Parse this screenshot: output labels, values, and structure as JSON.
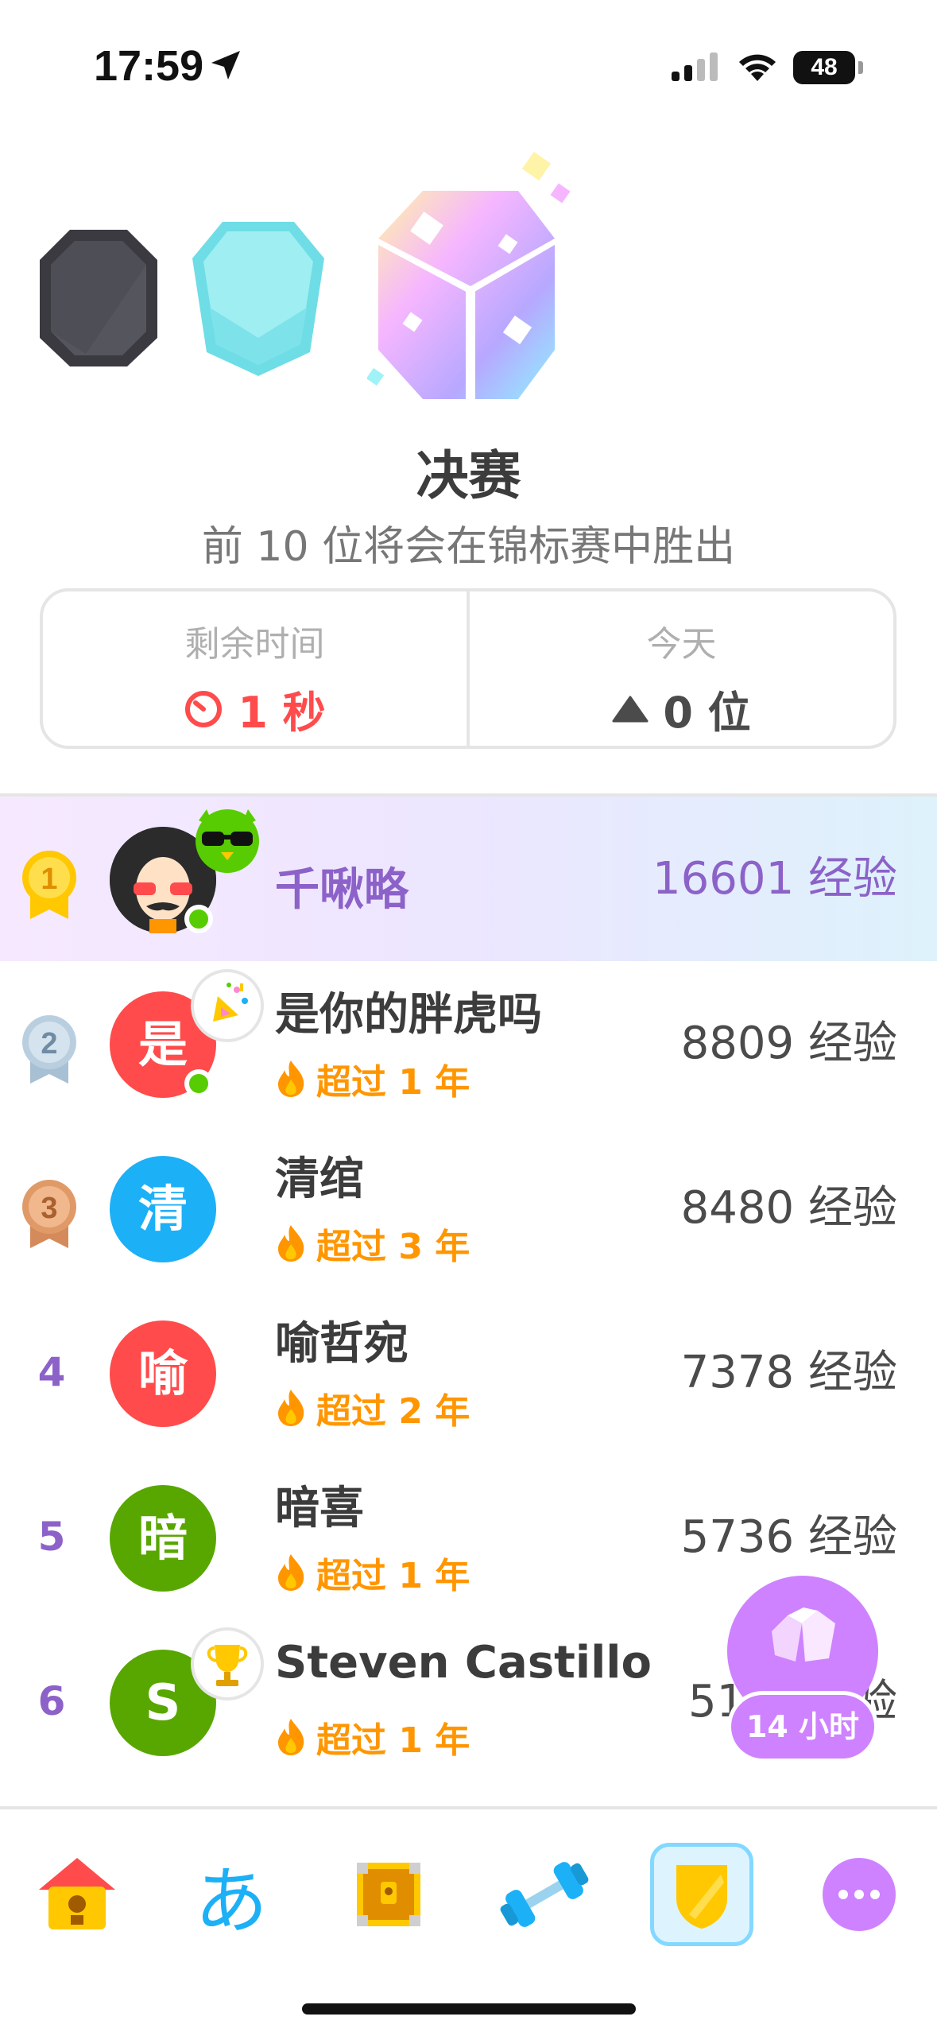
{
  "status_bar": {
    "time": "17:59",
    "battery": "48",
    "icons": [
      "location-arrow-icon",
      "cellular-signal-icon",
      "wifi-icon",
      "battery-icon"
    ]
  },
  "league": {
    "title": "决赛",
    "subtitle": "前 10 位将会在锦标赛中胜出",
    "gems": [
      "obsidian-gem-icon",
      "diamond-gem-icon",
      "tournament-gem-icon"
    ]
  },
  "info": {
    "time_left_label": "剩余时间",
    "time_left_value": "1 秒",
    "today_label": "今天",
    "today_value": "0 位"
  },
  "leaderboard": [
    {
      "rank": "1",
      "name": "千啾略",
      "streak": "",
      "xp": "16601 经验",
      "avatar_letter": "",
      "avatar_color": "#2b2b2b",
      "highlight": true
    },
    {
      "rank": "2",
      "name": "是你的胖虎吗",
      "streak": "超过 1 年",
      "xp": "8809 经验",
      "avatar_letter": "是",
      "avatar_color": "#ff4b4b"
    },
    {
      "rank": "3",
      "name": "清绾",
      "streak": "超过 3 年",
      "xp": "8480 经验",
      "avatar_letter": "清",
      "avatar_color": "#1cb0f6"
    },
    {
      "rank": "4",
      "name": "喻哲宛",
      "streak": "超过 2 年",
      "xp": "7378 经验",
      "avatar_letter": "喻",
      "avatar_color": "#ff4b4b"
    },
    {
      "rank": "5",
      "name": "暗喜",
      "streak": "超过 1 年",
      "xp": "5736 经验",
      "avatar_letter": "暗",
      "avatar_color": "#58a700"
    },
    {
      "rank": "6",
      "name": "Steven Castillo",
      "streak": "超过 1 年",
      "xp": "51",
      "xp_tail": "验",
      "avatar_letter": "S",
      "avatar_color": "#58a700"
    }
  ],
  "floating_chest": {
    "timer": "14 小时"
  },
  "nav": {
    "items": [
      "home-icon",
      "characters-icon",
      "treasure-chest-icon",
      "dumbbell-icon",
      "leagues-shield-icon",
      "more-icon"
    ],
    "hiragana": "あ",
    "active": "leagues-shield-icon"
  },
  "colors": {
    "purple": "#8c62c9",
    "red": "#ff4b4b",
    "orange": "#ff9600",
    "blue": "#1cb0f6",
    "green": "#58cc02"
  }
}
